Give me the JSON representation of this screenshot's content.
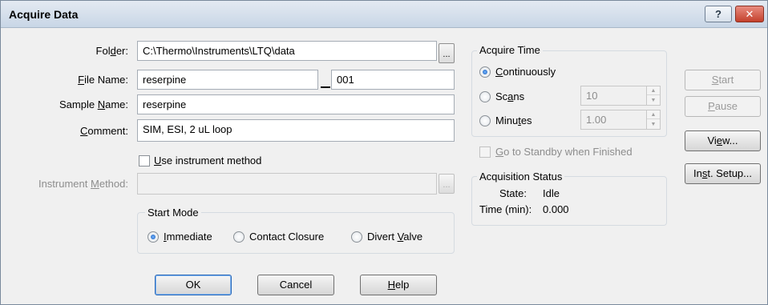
{
  "window": {
    "title": "Acquire Data",
    "help_glyph": "?",
    "close_glyph": "✕"
  },
  "form": {
    "folder_label": "Folder:",
    "folder_value": "C:\\Thermo\\Instruments\\LTQ\\data",
    "file_name_label": "File Name:",
    "file_name_value": "reserpine",
    "file_suffix_value": "001",
    "sample_name_label": "Sample Name:",
    "sample_name_value": "reserpine",
    "comment_label": "Comment:",
    "comment_value": "SIM, ESI, 2 uL loop",
    "use_method_label": "Use instrument method",
    "instrument_method_label": "Instrument Method:",
    "instrument_method_value": "",
    "browse_glyph": "..."
  },
  "start_mode": {
    "title": "Start Mode",
    "options": [
      "Immediate",
      "Contact Closure",
      "Divert Valve"
    ],
    "selected": "Immediate"
  },
  "acquire_time": {
    "title": "Acquire Time",
    "options": [
      "Continuously",
      "Scans",
      "Minutes"
    ],
    "selected": "Continuously",
    "scans_value": "10",
    "minutes_value": "1.00"
  },
  "standby_label": "Go to Standby when Finished",
  "status": {
    "title": "Acquisition Status",
    "state_label": "State:",
    "state_value": "Idle",
    "time_label": "Time (min):",
    "time_value": "0.000"
  },
  "buttons": {
    "start": "Start",
    "pause": "Pause",
    "view": "View...",
    "inst_setup": "Inst. Setup...",
    "ok": "OK",
    "cancel": "Cancel",
    "help": "Help"
  }
}
